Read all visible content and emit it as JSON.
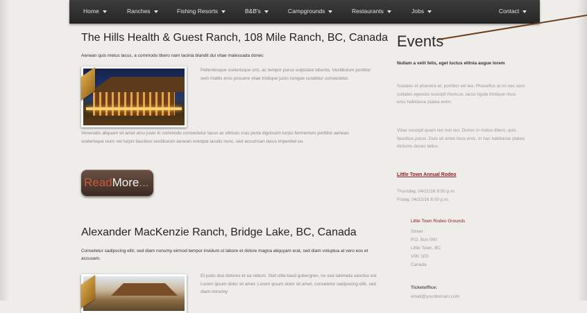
{
  "nav": {
    "items": [
      "Home",
      "Ranches",
      "Fishing Resorts",
      "B&B's",
      "Campgrounds",
      "Restaurants",
      "Jobs"
    ],
    "contact": "Contact"
  },
  "article1": {
    "title": "The Hills Health & Guest Ranch, 108 Mile Ranch, BC, Canada",
    "lead": "Aenean quis metus lacus, a commodo libero nam lacinia blandit dui vitae malesuada donec",
    "side_text": "Pellentesque scelerisque orci, ac tempor purus vulputate lobortis. Vestibulum porttitor sem mattis eros posuere vitae tristique justo congue curabitur consectetur.",
    "body": "Venenatis aliquam sit amet arcu justo in commodo consectetur lacus ac ultrices cras porta dignissim turpis fermentum porttitor aenean scelerisque nunc vel turpis faucibus vestibulum aenean volutpat iaculis nunc, sed accumsan lacus imperdiet eu.",
    "readmore": {
      "part1": "Read",
      "part2": "More",
      "part3": "..."
    }
  },
  "article2": {
    "title": "Alexander MacKenzie Ranch, Bridge Lake, BC, Canada",
    "lead": "Consetetur sadipscing elitr, sed diam nonumy eirmod tempor invidunt ut labore et dolore magna aliquyam erat, sed diam voluptua at vero eos et accusam.",
    "side_text": "Et justo duo dolores et ea rebum. Stet clita kasd gubergren, no sea takimata sanctus est Lorem ipsum dolor sit amet. Lorem ipsum dolor sit amet, consetetur sadipscing elitr, sed diam nonumy"
  },
  "sidebar": {
    "title": "Events",
    "bold": "Nullam a velit felis, eget luctus elitnia augue lorem",
    "para1": "Sodales et pharetra et, porttitor vel leo. Phasellus at mi nec sem sodales egestas suscipit rhoncus, lacus ligula tristique risus eros habitasse platea enim.",
    "para2": "Vitae suscipit quam leo non leo. Donec in metus libero, quis faucibus purus. Duis sit amet risus eros. In hac habitasse platea dictums donec tellus.",
    "event_link": "Little Town Annual Rodeo",
    "date1": "Thursday, 04/21/16 8:00 p.m.",
    "date2": "Friday, 04/22/16 8:00 p.m.",
    "venue": "Little Town Rodeo Grounds",
    "address": [
      "Street",
      "P.O. Box 000",
      "Little Town, BC",
      "V0K 1E0",
      "Canada"
    ],
    "ticket_label": "Ticketoffice:",
    "email": "email@yourdomain.com"
  },
  "colors": {
    "nav_bg": "#2e2e2e",
    "link": "#8a1c22",
    "accent_line": "#6a3d1a"
  }
}
